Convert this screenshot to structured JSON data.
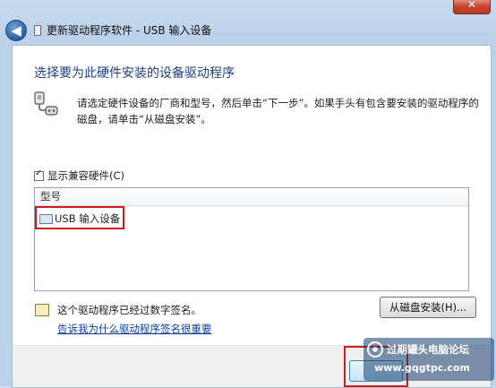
{
  "window": {
    "close_label": "✕",
    "title": "更新驱动程序软件 - USB 输入设备",
    "back_label": "◀"
  },
  "main": {
    "heading": "选择要为此硬件安装的设备驱动程序",
    "description": "请选定硬件设备的厂商和型号，然后单击“下一步”。如果手头有包含要安装的驱动程序的磁盘，请单击“从磁盘安装”。",
    "show_compatible_label": "显示兼容硬件(C)",
    "show_compatible_checked": true,
    "list": {
      "column_header": "型号",
      "items": [
        "USB 输入设备"
      ]
    },
    "signature_text": "这个驱动程序已经过数字签名。",
    "signature_link": "告诉我为什么驱动程序签名很重要",
    "have_disk_label": "从磁盘安装(H)..."
  },
  "watermark": {
    "title": "过期罐头电脑论坛",
    "url": "www.gqgtpc.com"
  },
  "colors": {
    "highlight": "#d11a1a",
    "heading": "#1f3f8a",
    "link": "#0b3fa6"
  }
}
